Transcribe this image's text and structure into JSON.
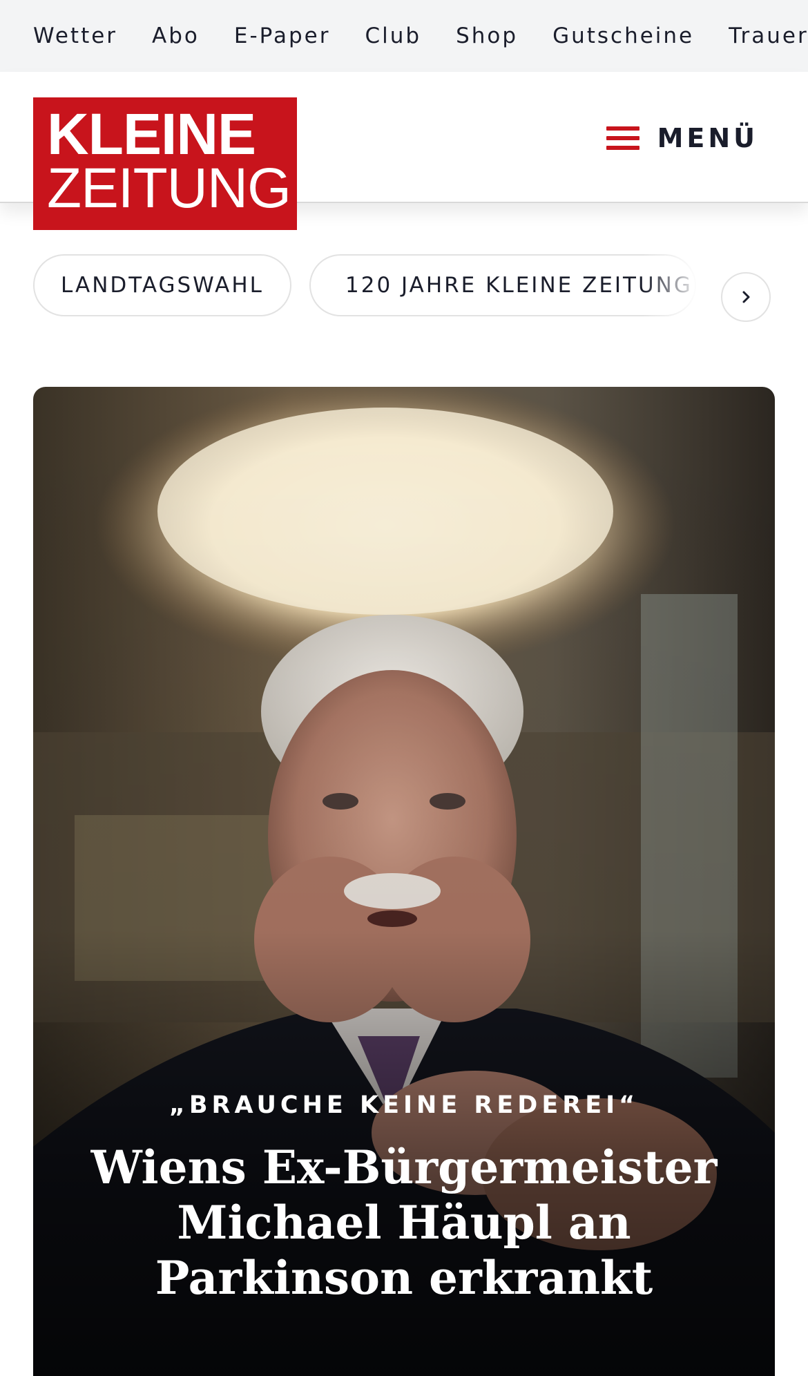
{
  "topbar": {
    "links": [
      "Wetter",
      "Abo",
      "E-Paper",
      "Club",
      "Shop",
      "Gutscheine",
      "Trauerportal"
    ]
  },
  "header": {
    "logo_line1": "KLEINE",
    "logo_line2": "ZEITUNG",
    "menu_label": "MENÜ"
  },
  "topics": {
    "chips": [
      "LANDTAGSWAHL",
      "120 JAHRE KLEINE ZEITUNG"
    ],
    "next_icon": "chevron-right-icon"
  },
  "hero": {
    "kicker": "„BRAUCHE KEINE REDEREI“",
    "title": "Wiens Ex-Bürgermeister Michael Häupl an Parkinson erkrankt"
  },
  "colors": {
    "brand_red": "#c8141c",
    "topbar_bg": "#f3f4f5",
    "text_dark": "#1a1d2b"
  }
}
